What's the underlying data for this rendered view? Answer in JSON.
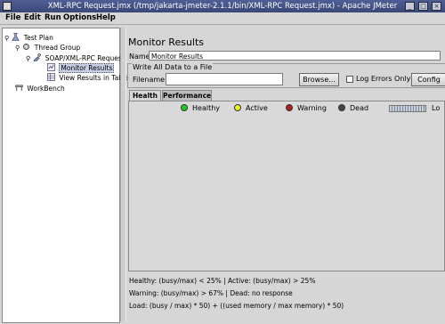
{
  "window": {
    "title": "XML-RPC Request.jmx (/tmp/jakarta-jmeter-2.1.1/bin/XML-RPC Request.jmx) - Apache JMeter"
  },
  "menu": [
    {
      "label": "File"
    },
    {
      "label": "Edit"
    },
    {
      "label": "Run"
    },
    {
      "label": "Options"
    },
    {
      "label": "Help"
    }
  ],
  "tree": [
    {
      "label": "Test Plan",
      "icon": "flask-icon"
    },
    {
      "label": "Thread Group",
      "icon": "gear-icon"
    },
    {
      "label": "SOAP/XML-RPC Request",
      "icon": "pipette-icon"
    },
    {
      "label": "Monitor Results",
      "icon": "chart-icon",
      "selected": true
    },
    {
      "label": "View Results in Table",
      "icon": "table-icon"
    },
    {
      "label": "WorkBench",
      "icon": "workbench-icon"
    }
  ],
  "panel": {
    "title": "Monitor Results",
    "name_label": "Name:",
    "name_value": "Monitor Results",
    "write_group_title": "Write All Data to a File",
    "filename_label": "Filename",
    "filename_value": "",
    "browse_label": "Browse...",
    "log_errors_label": "Log Errors Only",
    "log_errors_checked": false,
    "config_label": "Config"
  },
  "tabs": [
    {
      "label": "Health",
      "active": true
    },
    {
      "label": "Performance",
      "active": false
    }
  ],
  "legend": [
    {
      "label": "Healthy",
      "color": "#22cc22"
    },
    {
      "label": "Active",
      "color": "#eeee22"
    },
    {
      "label": "Warning",
      "color": "#aa2222"
    },
    {
      "label": "Dead",
      "color": "#444444"
    }
  ],
  "slider_label": "Lo",
  "footer": {
    "line1": "Healthy:  (busy/max) < 25%   |   Active:  (busy/max) > 25%",
    "line2": "Warning:  (busy/max) > 67%   |   Dead:  no response",
    "line3": "Load:  (busy / max) * 50) + ((used memory / max memory) * 50)"
  }
}
